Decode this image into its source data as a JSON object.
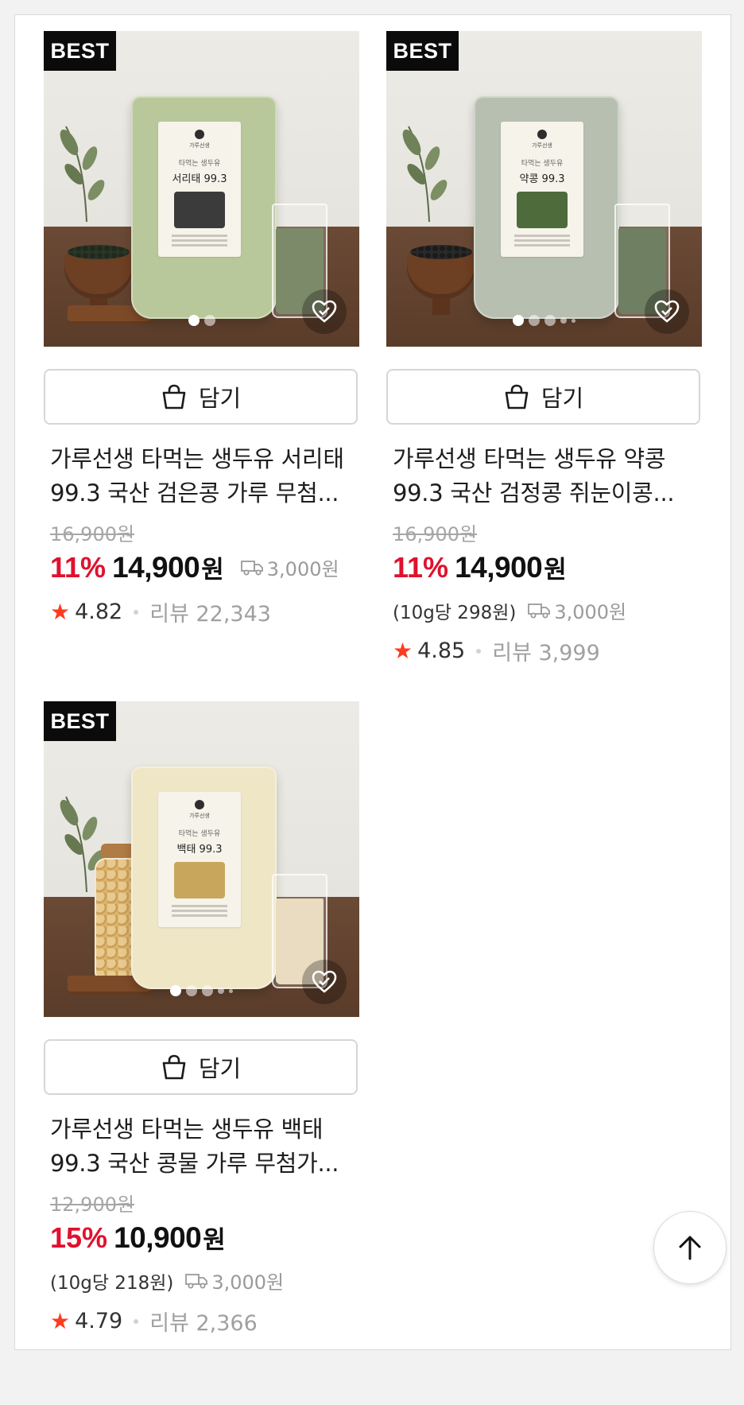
{
  "products": [
    {
      "badge": "BEST",
      "pack_brand": "가루선생",
      "pack_sub": "타먹는 생두유",
      "pack_title": "서리태 99.3",
      "pouch_color": "#b9c89a",
      "milk_color": "#7d8a6a",
      "image_dots": 2,
      "image_dot_active": 0,
      "cart_label": "담기",
      "title": "가루선생 타먹는 생두유 서리태 99.3 국산 검은콩 가루 무첨...",
      "original_price": "16,900원",
      "discount": "11%",
      "price": "14,900",
      "price_unit": "원",
      "unit_price": "",
      "shipping": "3,000원",
      "rating": "4.82",
      "reviews": "리뷰 22,343"
    },
    {
      "badge": "BEST",
      "pack_brand": "가루선생",
      "pack_sub": "타먹는 생두유",
      "pack_title": "약콩 99.3",
      "pouch_color": "#b7bfb0",
      "milk_color": "#6f7f62",
      "image_dots": 5,
      "image_dot_active": 0,
      "cart_label": "담기",
      "title": "가루선생 타먹는 생두유 약콩 99.3 국산 검정콩 쥐눈이콩...",
      "original_price": "16,900원",
      "discount": "11%",
      "price": "14,900",
      "price_unit": "원",
      "unit_price": "(10g당 298원)",
      "shipping": "3,000원",
      "rating": "4.85",
      "reviews": "리뷰 3,999"
    },
    {
      "badge": "BEST",
      "pack_brand": "가루선생",
      "pack_sub": "타먹는 생두유",
      "pack_title": "백태 99.3",
      "pouch_color": "#efe6c6",
      "milk_color": "#e9dcc1",
      "image_dots": 5,
      "image_dot_active": 0,
      "cart_label": "담기",
      "title": "가루선생 타먹는 생두유 백태 99.3 국산 콩물 가루 무첨가...",
      "original_price": "12,900원",
      "discount": "15%",
      "price": "10,900",
      "price_unit": "원",
      "unit_price": "(10g당 218원)",
      "shipping": "3,000원",
      "rating": "4.79",
      "reviews": "리뷰 2,366"
    }
  ],
  "icons": {
    "cart": "shopping-bag-icon",
    "wishlist": "heart-icon",
    "shipping": "truck-icon",
    "star": "star-icon",
    "scroll_top": "arrow-up-icon"
  },
  "colors": {
    "discount": "#e0112e",
    "star": "#ff3b1f",
    "badge_bg": "#0b0b0b"
  }
}
